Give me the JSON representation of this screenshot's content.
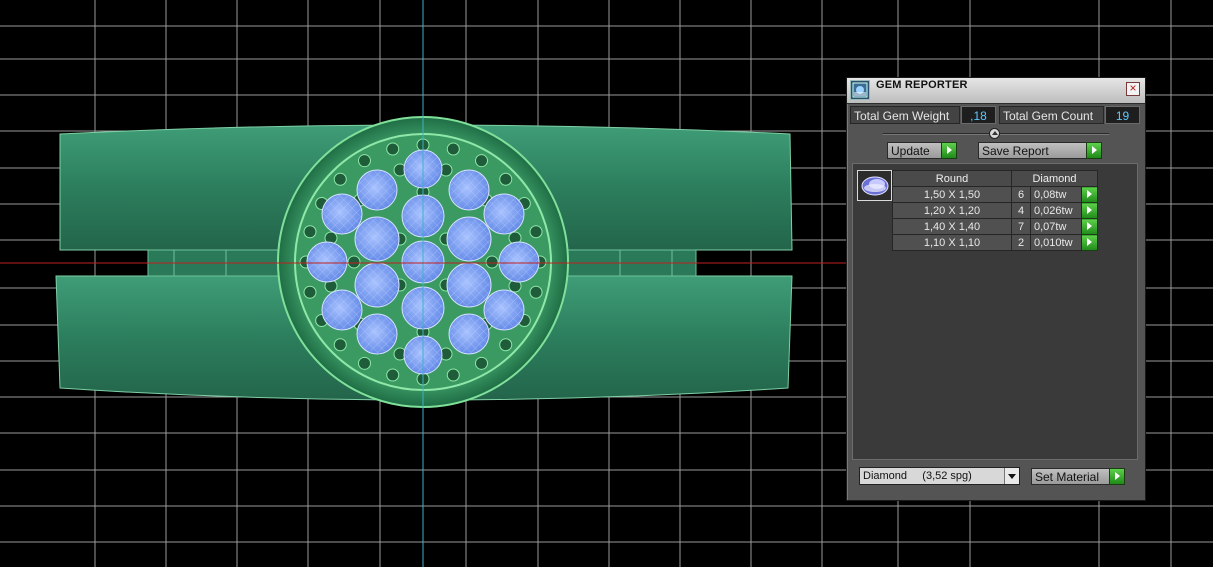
{
  "panel": {
    "title": "GEM REPORTER",
    "close_glyph": "×",
    "total_weight_label": "Total Gem Weight",
    "total_weight_value": ",18",
    "total_count_label": "Total Gem Count",
    "total_count_value": "19",
    "update_label": "Update",
    "save_report_label": "Save Report",
    "table": {
      "headers": [
        "Round",
        "Diamond"
      ],
      "rows": [
        {
          "size": "1,50 X 1,50",
          "count": "6",
          "weight": "0,08tw"
        },
        {
          "size": "1,20 X 1,20",
          "count": "4",
          "weight": "0,026tw"
        },
        {
          "size": "1,40 X 1,40",
          "count": "7",
          "weight": "0,07tw"
        },
        {
          "size": "1,10 X 1,10",
          "count": "2",
          "weight": "0,010tw"
        }
      ]
    },
    "material_value": "Diamond     (3,52 spg)",
    "set_material_label": "Set Material"
  },
  "colors": {
    "background": "#000000",
    "grid": "#9a9a9a",
    "axis_vertical": "#3fb0c8",
    "axis_horizontal": "#c02020",
    "band": "#2f8a66",
    "bezel": "#58c07a",
    "gem": "#7da2f0",
    "value_text": "#5ec8ff",
    "action_green": "#3fb030"
  },
  "icons": {
    "title": "gem-reporter-app-icon",
    "close": "close-icon",
    "arrow": "play-arrow-icon",
    "dropdown": "chevron-down-icon",
    "gem": "oval-gem-icon"
  }
}
